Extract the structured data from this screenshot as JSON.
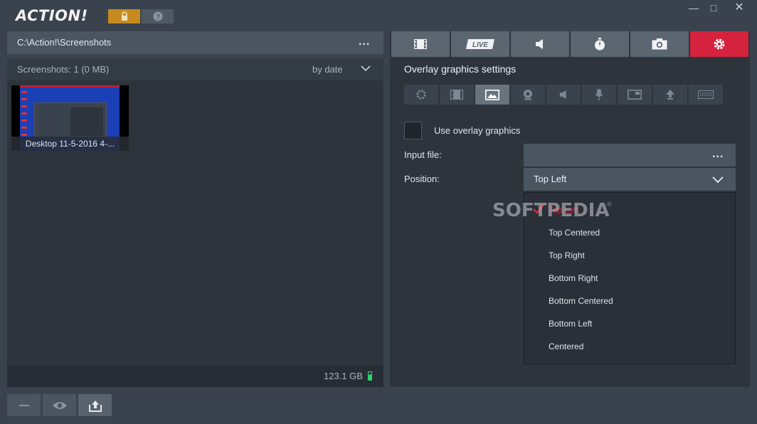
{
  "app": {
    "logo": "ACTION!"
  },
  "window_controls": [
    "—",
    "□",
    "✕"
  ],
  "left": {
    "path": "C:\\Action!\\Screenshots",
    "path_dots": "...",
    "screenshots_count": "Screenshots: 1 (0 MB)",
    "sort_label": "by date",
    "thumbnail_caption": "Desktop 11-5-2016 4-...",
    "disk_free": "123.1 GB"
  },
  "right": {
    "tabs": [
      "video-tab",
      "live-tab",
      "audio-tab",
      "benchmark-tab",
      "screenshot-tab",
      "settings-tab"
    ],
    "live_label": "LIVE",
    "section_title": "Overlay graphics settings",
    "use_overlay_label": "Use overlay graphics",
    "use_overlay_checked": false,
    "input_file_label": "Input file:",
    "input_file_value": "",
    "input_file_dots": "...",
    "position_label": "Position:",
    "position_value": "Top Left",
    "position_options": [
      "Top Left",
      "Top Centered",
      "Top Right",
      "Bottom Right",
      "Bottom Centered",
      "Bottom Left",
      "Centered"
    ]
  },
  "watermark": {
    "text": "SOFTPEDIA",
    "reg": "®"
  },
  "colors": {
    "accent": "#d5233f",
    "lock": "#c68b1e",
    "background": "#3a434d",
    "panel": "#2d343c"
  }
}
